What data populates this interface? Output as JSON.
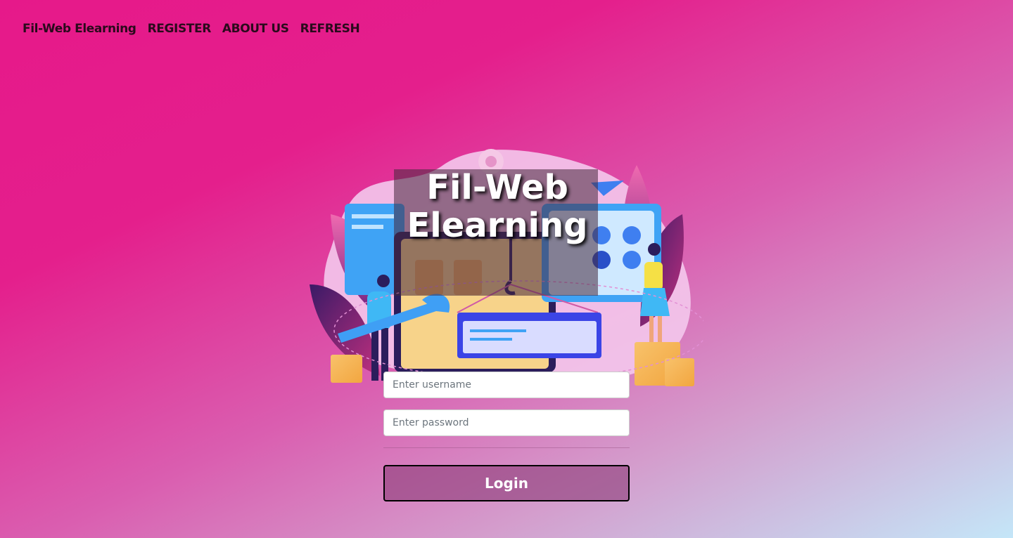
{
  "nav": {
    "brand": "Fil-Web Elearning",
    "items": [
      "REGISTER",
      "ABOUT US",
      "REFRESH"
    ]
  },
  "hero": {
    "title": "Fil-Web Elearning"
  },
  "form": {
    "username_placeholder": "Enter username",
    "password_placeholder": "Enter password",
    "login_label": "Login"
  },
  "colors": {
    "background_start": "#e6198a",
    "background_end": "#c4e6f8",
    "nav_text": "#2a0a1c"
  }
}
